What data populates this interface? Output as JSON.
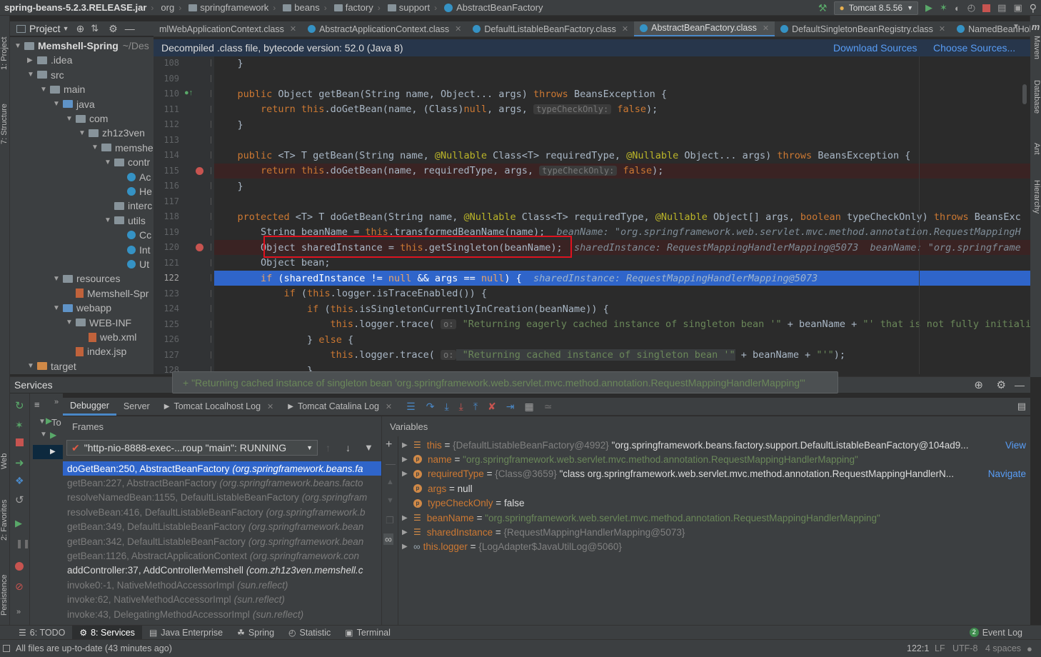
{
  "breadcrumb": [
    "spring-beans-5.2.3.RELEASE.jar",
    "org",
    "springframework",
    "beans",
    "factory",
    "support",
    "AbstractBeanFactory"
  ],
  "run_config": "Tomcat 8.5.56",
  "left_stripe": [
    "1: Project",
    "7: Structure",
    "Web",
    "2: Favorites",
    "Persistence"
  ],
  "right_stripe": [
    "Maven",
    "Database",
    "Ant",
    "Hierarchy"
  ],
  "project": {
    "header": "Project",
    "tree": [
      {
        "label": "Memshell-Spring",
        "hint": "~/Des",
        "depth": 0,
        "open": true,
        "kind": "folder"
      },
      {
        "label": ".idea",
        "depth": 1,
        "open": false,
        "kind": "folder"
      },
      {
        "label": "src",
        "depth": 1,
        "open": true,
        "kind": "folder"
      },
      {
        "label": "main",
        "depth": 2,
        "open": true,
        "kind": "folder"
      },
      {
        "label": "java",
        "depth": 3,
        "open": true,
        "kind": "folder-blue"
      },
      {
        "label": "com",
        "depth": 4,
        "open": true,
        "kind": "folder"
      },
      {
        "label": "zh1z3ven",
        "depth": 5,
        "open": true,
        "kind": "folder"
      },
      {
        "label": "memshe",
        "depth": 6,
        "open": true,
        "kind": "folder"
      },
      {
        "label": "contr",
        "depth": 7,
        "open": true,
        "kind": "folder"
      },
      {
        "label": "Ac",
        "depth": 8,
        "kind": "class"
      },
      {
        "label": "He",
        "depth": 8,
        "kind": "class"
      },
      {
        "label": "interc",
        "depth": 7,
        "kind": "folder"
      },
      {
        "label": "utils",
        "depth": 7,
        "open": true,
        "kind": "folder"
      },
      {
        "label": "Cc",
        "depth": 8,
        "kind": "class"
      },
      {
        "label": "Int",
        "depth": 8,
        "kind": "class"
      },
      {
        "label": "Ut",
        "depth": 8,
        "kind": "class"
      },
      {
        "label": "resources",
        "depth": 3,
        "open": true,
        "kind": "folder"
      },
      {
        "label": "Memshell-Spr",
        "depth": 4,
        "kind": "xml"
      },
      {
        "label": "webapp",
        "depth": 3,
        "open": true,
        "kind": "folder-blue"
      },
      {
        "label": "WEB-INF",
        "depth": 4,
        "open": true,
        "kind": "folder"
      },
      {
        "label": "web.xml",
        "depth": 5,
        "kind": "xml"
      },
      {
        "label": "index.jsp",
        "depth": 4,
        "kind": "xml"
      },
      {
        "label": "target",
        "depth": 1,
        "open": true,
        "kind": "folder-orange"
      }
    ]
  },
  "tabs": [
    {
      "label": "mlWebApplicationContext.class",
      "active": false
    },
    {
      "label": "AbstractApplicationContext.class",
      "active": false
    },
    {
      "label": "DefaultListableBeanFactory.class",
      "active": false
    },
    {
      "label": "AbstractBeanFactory.class",
      "active": true
    },
    {
      "label": "DefaultSingletonBeanRegistry.class",
      "active": false
    },
    {
      "label": "NamedBeanHolder.cla",
      "active": false
    }
  ],
  "banner": {
    "text": "Decompiled .class file, bytecode version: 52.0 (Java 8)",
    "download": "Download Sources",
    "choose": "Choose Sources..."
  },
  "editor": {
    "lines": [
      {
        "n": "108",
        "tokens": [
          [
            "p",
            "    }"
          ]
        ]
      },
      {
        "n": "109",
        "tokens": []
      },
      {
        "n": "110",
        "tokens": [
          [
            "k",
            "    public "
          ],
          [
            "p",
            "Object getBean(String name, Object... args) "
          ],
          [
            "k",
            "throws "
          ],
          [
            "p",
            "BeansException {"
          ]
        ]
      },
      {
        "n": "111",
        "tokens": [
          [
            "k",
            "        return this"
          ],
          [
            "p",
            ".doGetBean(name, (Class)"
          ],
          [
            "k",
            "null"
          ],
          [
            "p",
            ", args, "
          ],
          [
            "h",
            "typeCheckOnly:"
          ],
          [
            "k",
            " false"
          ],
          [
            "p",
            ");"
          ]
        ]
      },
      {
        "n": "112",
        "tokens": [
          [
            "p",
            "    }"
          ]
        ]
      },
      {
        "n": "113",
        "tokens": []
      },
      {
        "n": "114",
        "tokens": [
          [
            "k",
            "    public "
          ],
          [
            "p",
            "<T> T getBean(String name, "
          ],
          [
            "a",
            "@Nullable "
          ],
          [
            "p",
            "Class<T> requiredType, "
          ],
          [
            "a",
            "@Nullable "
          ],
          [
            "p",
            "Object... args) "
          ],
          [
            "k",
            "throws "
          ],
          [
            "p",
            "BeansException {"
          ]
        ]
      },
      {
        "n": "115",
        "tokens": [
          [
            "k",
            "        return this"
          ],
          [
            "p",
            ".doGetBean(name, requiredType, args, "
          ],
          [
            "h",
            "typeCheckOnly:"
          ],
          [
            "k",
            " false"
          ],
          [
            "p",
            ");"
          ]
        ]
      },
      {
        "n": "116",
        "tokens": [
          [
            "p",
            "    }"
          ]
        ]
      },
      {
        "n": "117",
        "tokens": []
      },
      {
        "n": "118",
        "tokens": [
          [
            "k",
            "    protected "
          ],
          [
            "p",
            "<T> T doGetBean(String name, "
          ],
          [
            "a",
            "@Nullable "
          ],
          [
            "p",
            "Class<T> requiredType, "
          ],
          [
            "a",
            "@Nullable "
          ],
          [
            "p",
            "Object[] args, "
          ],
          [
            "k",
            "boolean "
          ],
          [
            "p",
            "typeCheckOnly) "
          ],
          [
            "k",
            "throws "
          ],
          [
            "p",
            "BeansExc"
          ]
        ]
      },
      {
        "n": "119",
        "tokens": [
          [
            "p",
            "        String beanName = "
          ],
          [
            "k",
            "this"
          ],
          [
            "p",
            ".transformedBeanName(name);  "
          ],
          [
            "d",
            "beanName: \"org.springframework.web.servlet.mvc.method.annotation.RequestMappingH"
          ]
        ]
      },
      {
        "n": "120",
        "tokens": [
          [
            "p",
            "        Object sharedInstance = "
          ],
          [
            "k",
            "this"
          ],
          [
            "p",
            ".getSingleton(beanName);  "
          ],
          [
            "d",
            "sharedInstance: RequestMappingHandlerMapping@5073  beanName: \"org.springframe"
          ]
        ]
      },
      {
        "n": "121",
        "tokens": [
          [
            "p",
            "        Object bean;"
          ]
        ]
      },
      {
        "n": "122",
        "tokens": [
          [
            "k",
            "        if "
          ],
          [
            "p",
            "(sharedInstance != "
          ],
          [
            "k",
            "null "
          ],
          [
            "p",
            "&& args == "
          ],
          [
            "k",
            "null"
          ],
          [
            "p",
            ") {  "
          ],
          [
            "d",
            "sharedInstance: RequestMappingHandlerMapping@5073"
          ]
        ]
      },
      {
        "n": "123",
        "tokens": [
          [
            "k",
            "            if "
          ],
          [
            "p",
            "("
          ],
          [
            "k",
            "this"
          ],
          [
            "p",
            ".logger.isTraceEnabled()) {"
          ]
        ]
      },
      {
        "n": "124",
        "tokens": [
          [
            "k",
            "                if "
          ],
          [
            "p",
            "("
          ],
          [
            "k",
            "this"
          ],
          [
            "p",
            ".isSingletonCurrentlyInCreation(beanName)) {"
          ]
        ]
      },
      {
        "n": "125",
        "tokens": [
          [
            "k",
            "                    this"
          ],
          [
            "p",
            ".logger.trace( "
          ],
          [
            "h",
            "o:"
          ],
          [
            "s",
            " \"Returning eagerly cached instance of singleton bean '\""
          ],
          [
            "p",
            " + beanName + "
          ],
          [
            "s",
            "\"' that is not fully initiali"
          ]
        ]
      },
      {
        "n": "126",
        "tokens": [
          [
            "p",
            "                } "
          ],
          [
            "k",
            "else "
          ],
          [
            "p",
            "{"
          ]
        ]
      },
      {
        "n": "127",
        "tokens": [
          [
            "k",
            "                    this"
          ],
          [
            "p",
            ".logger.trace( "
          ],
          [
            "h",
            "o:"
          ],
          [
            "s",
            " \"Returning cached instance of singleton bean '\""
          ],
          [
            "p",
            " + beanName + "
          ],
          [
            "s",
            "\"'\""
          ],
          [
            "p",
            ");"
          ]
        ]
      },
      {
        "n": "128",
        "tokens": [
          [
            "p",
            "                }"
          ]
        ]
      }
    ],
    "tooltip": "+ \"Returning cached instance of singleton bean 'org.springframework.web.servlet.mvc.method.annotation.RequestMappingHandlerMapping'\""
  },
  "services": {
    "title": "Services",
    "tree_label": "To",
    "tabs": [
      "Debugger",
      "Server",
      "Tomcat Localhost Log",
      "Tomcat Catalina Log"
    ],
    "frames_title": "Frames",
    "thread": "\"http-nio-8888-exec-...roup \"main\": RUNNING",
    "frames": [
      {
        "method": "doGetBean:250, AbstractBeanFactory",
        "pkg": "(org.springframework.beans.fa",
        "sel": true
      },
      {
        "method": "getBean:227, AbstractBeanFactory",
        "pkg": "(org.springframework.beans.facto"
      },
      {
        "method": "resolveNamedBean:1155, DefaultListableBeanFactory",
        "pkg": "(org.springfram"
      },
      {
        "method": "resolveBean:416, DefaultListableBeanFactory",
        "pkg": "(org.springframework.b"
      },
      {
        "method": "getBean:349, DefaultListableBeanFactory",
        "pkg": "(org.springframework.bean"
      },
      {
        "method": "getBean:342, DefaultListableBeanFactory",
        "pkg": "(org.springframework.bean"
      },
      {
        "method": "getBean:1126, AbstractApplicationContext",
        "pkg": "(org.springframework.con"
      },
      {
        "method": "addController:37, AddControllerMemshell",
        "pkg": "(com.zh1z3ven.memshell.c",
        "bright": true
      },
      {
        "method": "invoke0:-1, NativeMethodAccessorImpl",
        "pkg": "(sun.reflect)"
      },
      {
        "method": "invoke:62, NativeMethodAccessorImpl",
        "pkg": "(sun.reflect)"
      },
      {
        "method": "invoke:43, DelegatingMethodAccessorImpl",
        "pkg": "(sun.reflect)"
      }
    ],
    "vars_title": "Variables",
    "vars": [
      {
        "expand": true,
        "icon": "list",
        "name": "this",
        "eq": " = ",
        "type": "{DefaultListableBeanFactory@4992}",
        "value": " \"org.springframework.beans.factory.support.DefaultListableBeanFactory@104ad9...",
        "link": "View"
      },
      {
        "expand": true,
        "icon": "p",
        "name": "name",
        "eq": " = ",
        "str": "\"org.springframework.web.servlet.mvc.method.annotation.RequestMappingHandlerMapping\""
      },
      {
        "expand": true,
        "icon": "p",
        "name": "requiredType",
        "eq": " = ",
        "type": "{Class@3659}",
        "value": " \"class org.springframework.web.servlet.mvc.method.annotation.RequestMappingHandlerN...",
        "link": "Navigate"
      },
      {
        "expand": false,
        "icon": "p",
        "name": "args",
        "eq": " = ",
        "value": "null"
      },
      {
        "expand": false,
        "icon": "p",
        "name": "typeCheckOnly",
        "eq": " = ",
        "value": "false"
      },
      {
        "expand": true,
        "icon": "list",
        "name": "beanName",
        "eq": " = ",
        "str": "\"org.springframework.web.servlet.mvc.method.annotation.RequestMappingHandlerMapping\""
      },
      {
        "expand": true,
        "icon": "list",
        "name": "sharedInstance",
        "eq": " = ",
        "type": "{RequestMappingHandlerMapping@5073}"
      },
      {
        "expand": true,
        "icon": "oo",
        "name": "this.logger",
        "eq": " = ",
        "type": "{LogAdapter$JavaUtilLog@5060}"
      }
    ]
  },
  "toolwindows": [
    {
      "label": "6: TODO",
      "active": false
    },
    {
      "label": "8: Services",
      "active": true
    },
    {
      "label": "Java Enterprise",
      "active": false
    },
    {
      "label": "Spring",
      "active": false
    },
    {
      "label": "Statistic",
      "active": false
    },
    {
      "label": "Terminal",
      "active": false
    }
  ],
  "event_log": {
    "count": "2",
    "label": "Event Log"
  },
  "status": {
    "message": "All files are up-to-date (43 minutes ago)",
    "position": "122:1",
    "line_sep": "LF",
    "encoding": "UTF-8",
    "indent": "4 spaces"
  },
  "colors": {
    "accent": "#4a88c7",
    "selection": "#2f65ca",
    "breakpoint": "#c75450",
    "exec_line": "#2f65ca",
    "highlight_box": "#e0121f"
  }
}
